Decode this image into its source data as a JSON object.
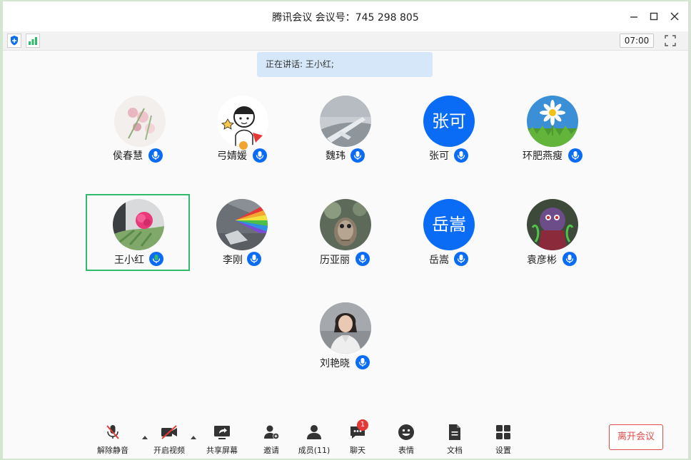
{
  "window": {
    "title": "腾讯会议 会议号：745 298 805"
  },
  "status": {
    "timer": "07:00",
    "speaking": "正在讲话: 王小红;"
  },
  "participants": [
    {
      "name": "侯春慧",
      "initials": "",
      "mic": "on"
    },
    {
      "name": "弓婧媛",
      "initials": "",
      "mic": "on"
    },
    {
      "name": "魏玮",
      "initials": "",
      "mic": "on"
    },
    {
      "name": "张可",
      "initials": "张可",
      "mic": "on"
    },
    {
      "name": "环肥燕瘦",
      "initials": "",
      "mic": "on"
    },
    {
      "name": "王小红",
      "initials": "",
      "mic": "speaking"
    },
    {
      "name": "李刚",
      "initials": "",
      "mic": "on"
    },
    {
      "name": "历亚丽",
      "initials": "",
      "mic": "on"
    },
    {
      "name": "岳嵩",
      "initials": "岳嵩",
      "mic": "on"
    },
    {
      "name": "袁彦彬",
      "initials": "",
      "mic": "on"
    },
    {
      "name": "刘艳晓",
      "initials": "",
      "mic": "on"
    }
  ],
  "toolbar": {
    "unmute": "解除静音",
    "start_video": "开启视频",
    "share_screen": "共享屏幕",
    "invite": "邀请",
    "members": "成员(11)",
    "chat": "聊天",
    "chat_badge": "1",
    "reactions": "表情",
    "docs": "文档",
    "settings": "设置",
    "leave": "离开会议"
  },
  "colors": {
    "accent": "#0a6cf5",
    "active_border": "#2fbb6a",
    "leave": "#e14b4b",
    "speaking_bg": "#d6e7f9"
  }
}
